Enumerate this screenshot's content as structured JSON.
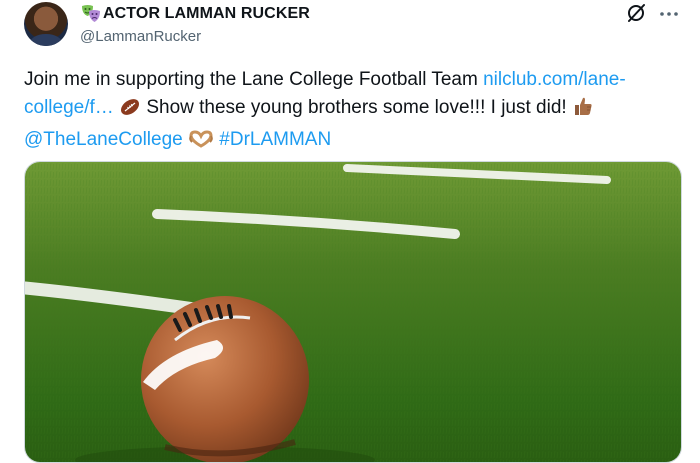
{
  "author": {
    "display_name": "ACTOR LAMMAN RUCKER",
    "handle": "@LammanRucker"
  },
  "tweet": {
    "text_1": "Join me in supporting the Lane College Football Team ",
    "link_1": "nilclub.com/lane-college/f…",
    "text_2": " Show these young brothers some love!!! I just did! ",
    "mention": "@TheLaneCollege",
    "hashtag": "#DrLAMMAN"
  },
  "icons": {
    "masks": "theater-masks-icon",
    "grok": "grok-icon",
    "more": "more-icon",
    "football_emoji": "football-emoji",
    "thumbs_up_emoji": "thumbs-up-emoji",
    "heart_hands_emoji": "heart-hands-emoji"
  },
  "colors": {
    "link": "#1d9bf0",
    "text": "#0f1419",
    "secondary": "#536471"
  }
}
